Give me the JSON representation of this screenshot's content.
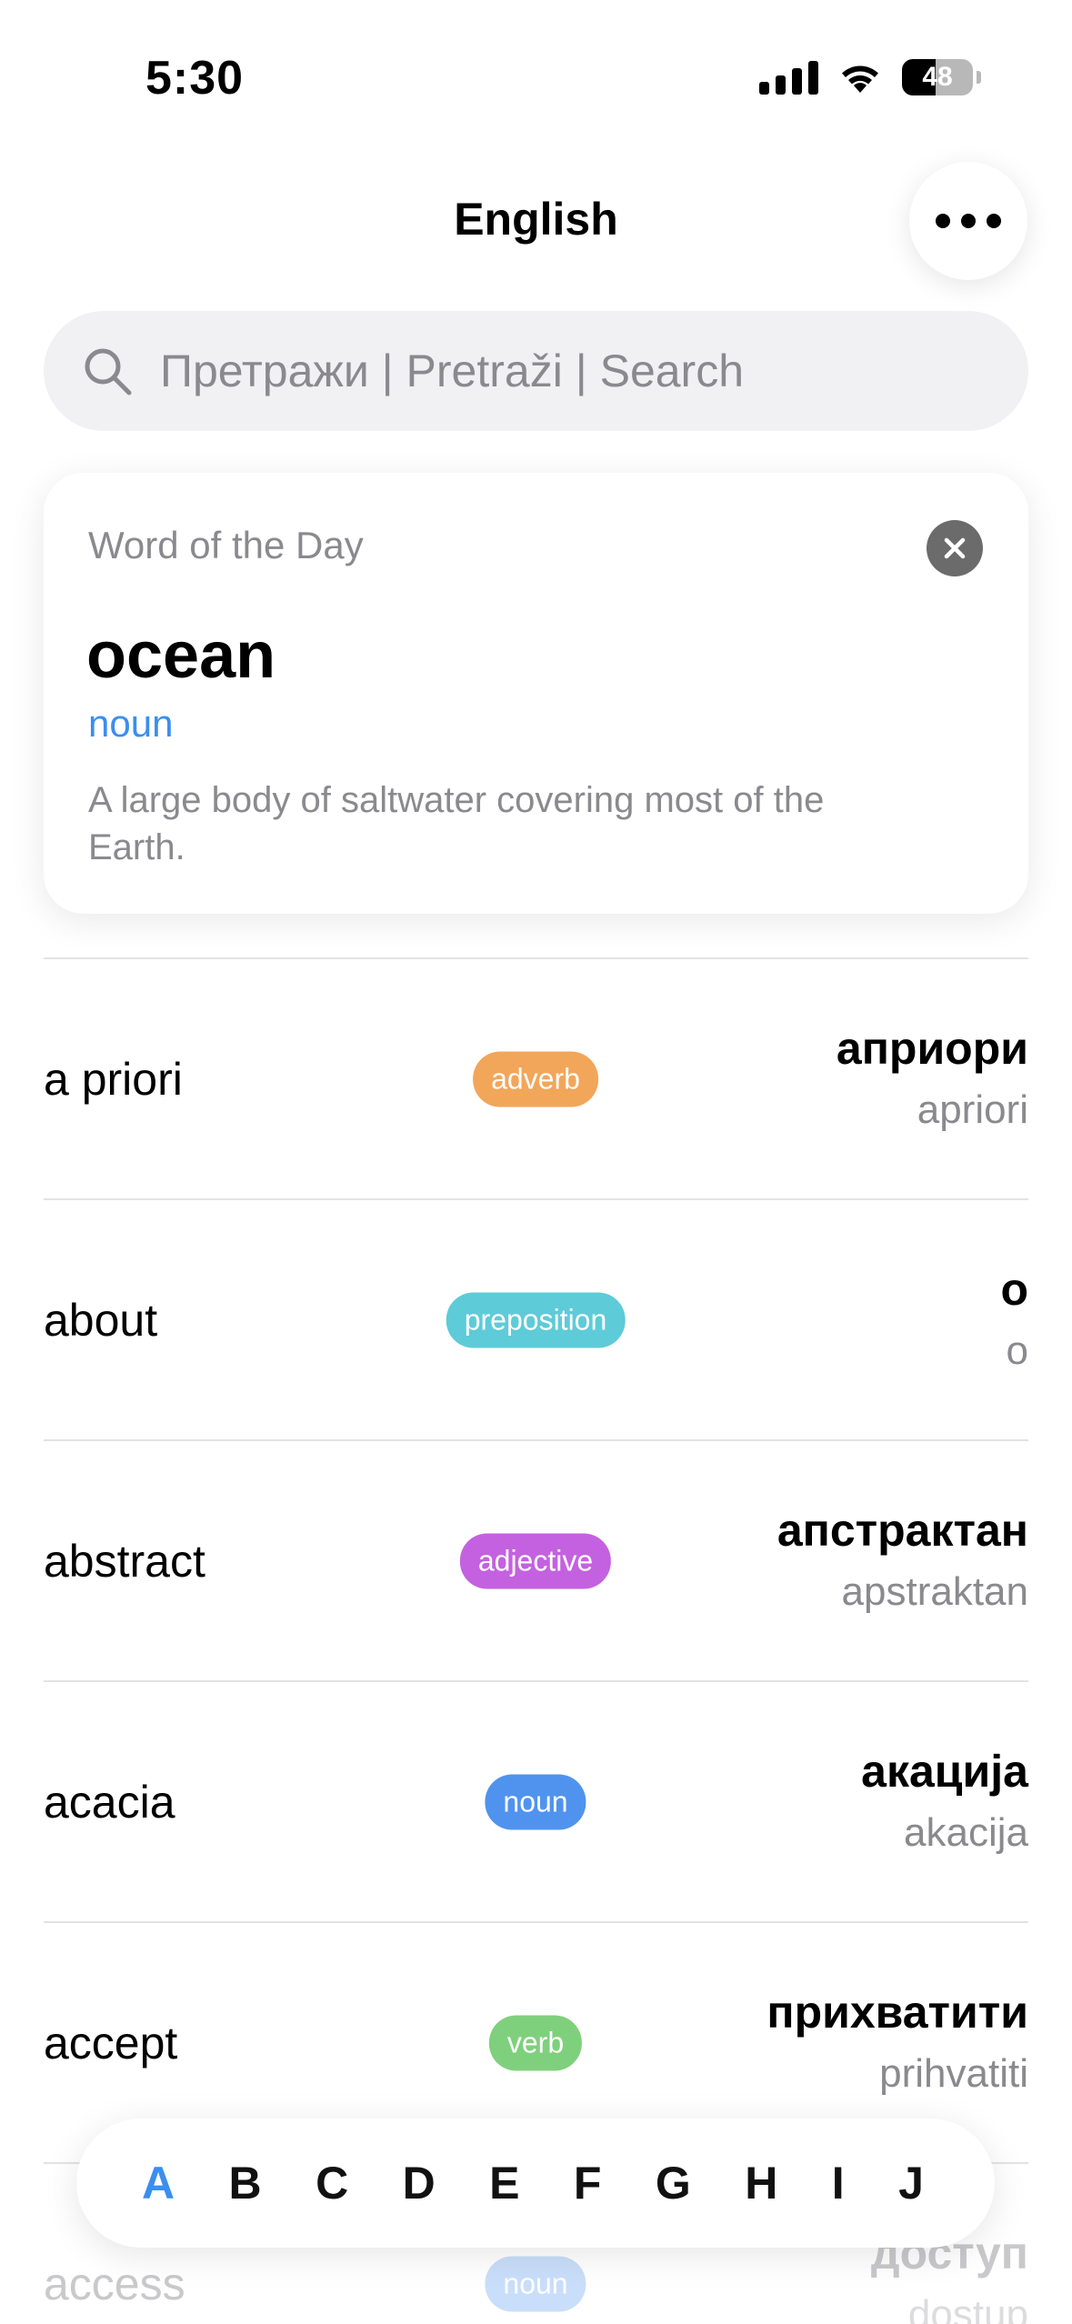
{
  "status_bar": {
    "time": "5:30",
    "battery": "48"
  },
  "header": {
    "title": "English"
  },
  "search": {
    "placeholder": "Претражи | Pretraži | Search"
  },
  "word_of_the_day": {
    "heading": "Word of the Day",
    "word": "ocean",
    "part_of_speech": "noun",
    "definition": "A large body of saltwater covering most of the Earth."
  },
  "entries": [
    {
      "word": "a priori",
      "pos": "adverb",
      "pos_color": "#f2a65a",
      "cyrillic": "априори",
      "latin": "apriori"
    },
    {
      "word": "about",
      "pos": "preposition",
      "pos_color": "#5ecbd8",
      "cyrillic": "о",
      "latin": "o"
    },
    {
      "word": "abstract",
      "pos": "adjective",
      "pos_color": "#c461e0",
      "cyrillic": "апстрактан",
      "latin": "apstraktan"
    },
    {
      "word": "acacia",
      "pos": "noun",
      "pos_color": "#4f93ef",
      "cyrillic": "акација",
      "latin": "akacija"
    },
    {
      "word": "accept",
      "pos": "verb",
      "pos_color": "#7fd07d",
      "cyrillic": "прихватити",
      "latin": "prihvatiti"
    },
    {
      "word": "access",
      "pos": "noun",
      "pos_color": "#4f93ef",
      "cyrillic": "доступ",
      "latin": "dostup"
    }
  ],
  "alphabet": {
    "letters": [
      "A",
      "B",
      "C",
      "D",
      "E",
      "F",
      "G",
      "H",
      "I",
      "J"
    ],
    "active": "A",
    "active_color": "#3a8ef0"
  }
}
